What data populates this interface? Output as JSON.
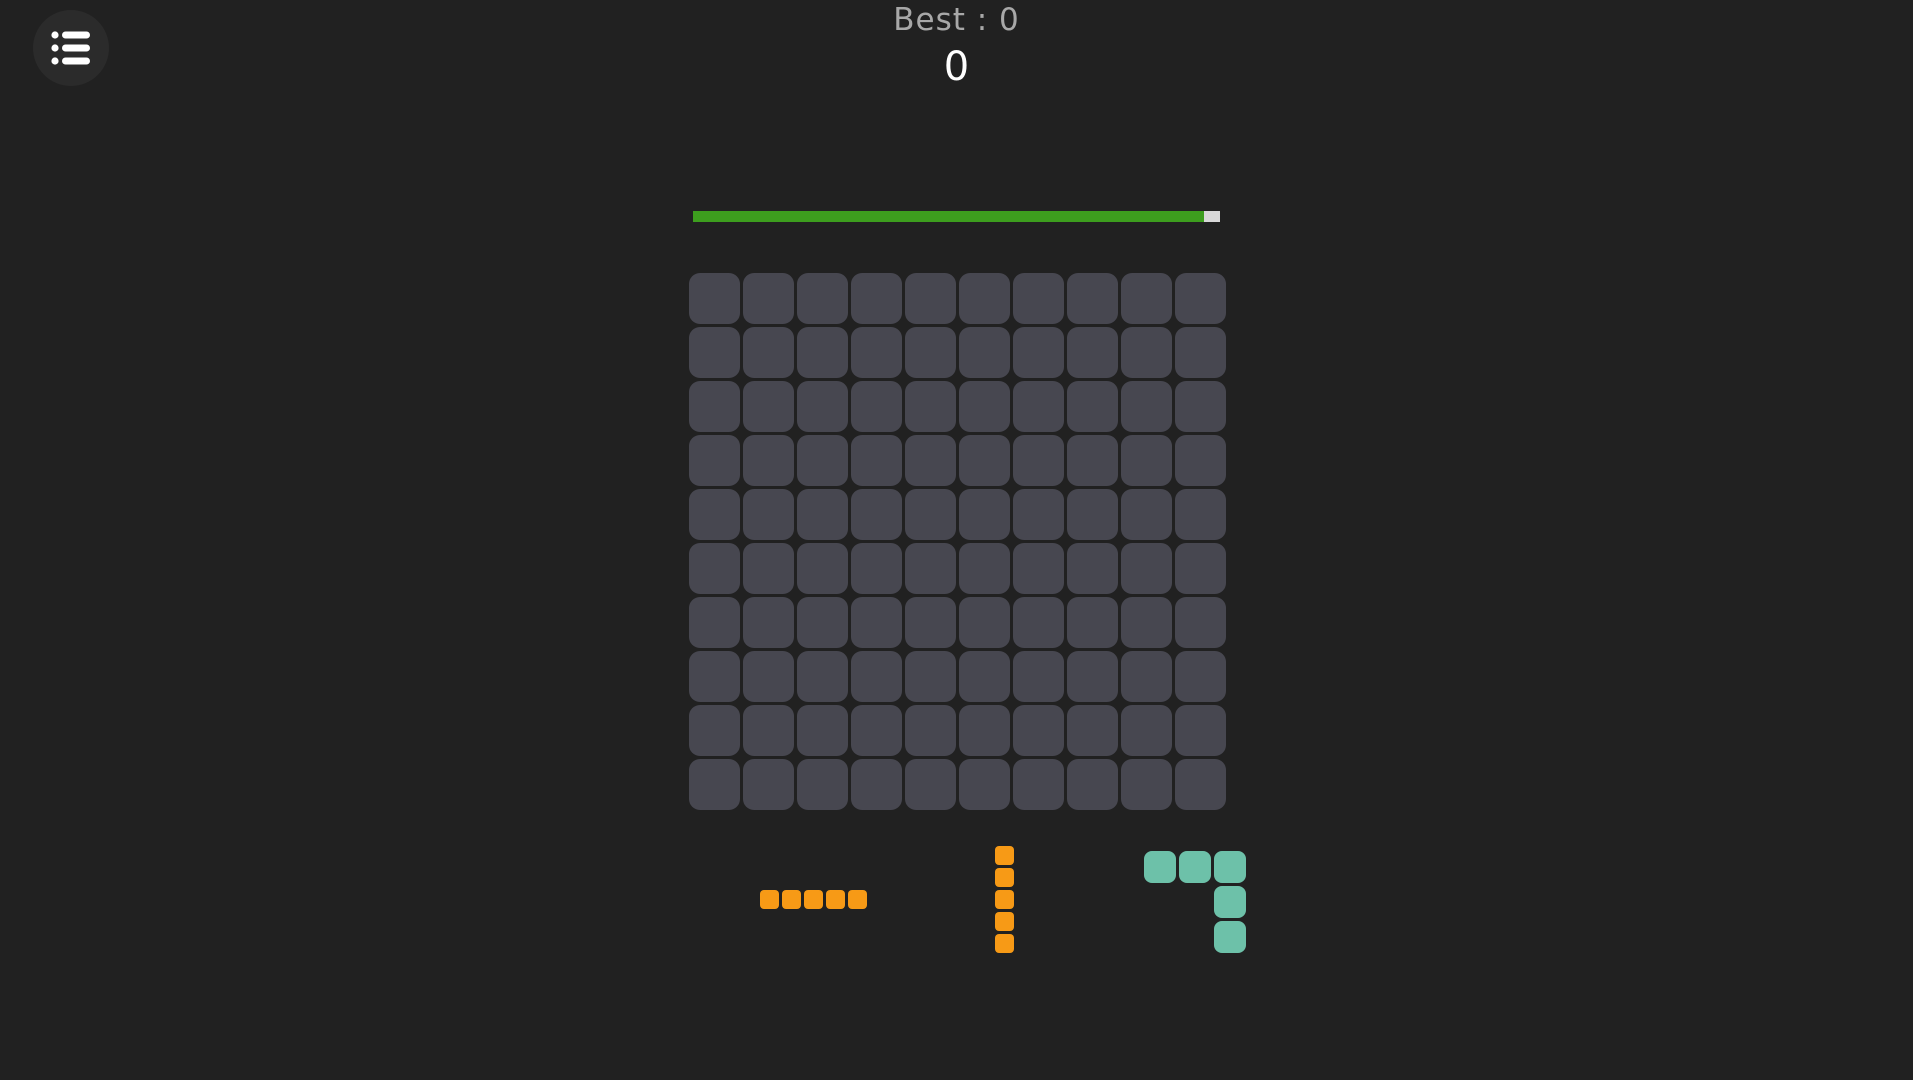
{
  "menu": {
    "icon": "list-icon"
  },
  "header": {
    "best_text": "Best : 0",
    "score": "0"
  },
  "progress": {
    "fraction": 0.97
  },
  "board": {
    "rows": 10,
    "cols": 10,
    "cell_color": "#474750"
  },
  "colors": {
    "background": "#212121",
    "progress_fill": "#3d9e1e",
    "progress_track": "#d8d8d8",
    "orange": "#f79a16",
    "teal": "#6dc1a9"
  },
  "pieces": [
    {
      "name": "piece-orange-horizontal-5",
      "color": "#f79a16",
      "blocks": [
        [
          0,
          0
        ],
        [
          0,
          1
        ],
        [
          0,
          2
        ],
        [
          0,
          3
        ],
        [
          0,
          4
        ]
      ]
    },
    {
      "name": "piece-orange-vertical-5",
      "color": "#f79a16",
      "blocks": [
        [
          0,
          0
        ],
        [
          1,
          0
        ],
        [
          2,
          0
        ],
        [
          3,
          0
        ],
        [
          4,
          0
        ]
      ]
    },
    {
      "name": "piece-teal-corner",
      "color": "#6dc1a9",
      "blocks": [
        [
          0,
          0
        ],
        [
          0,
          1
        ],
        [
          0,
          2
        ],
        [
          1,
          2
        ],
        [
          2,
          2
        ]
      ]
    }
  ]
}
